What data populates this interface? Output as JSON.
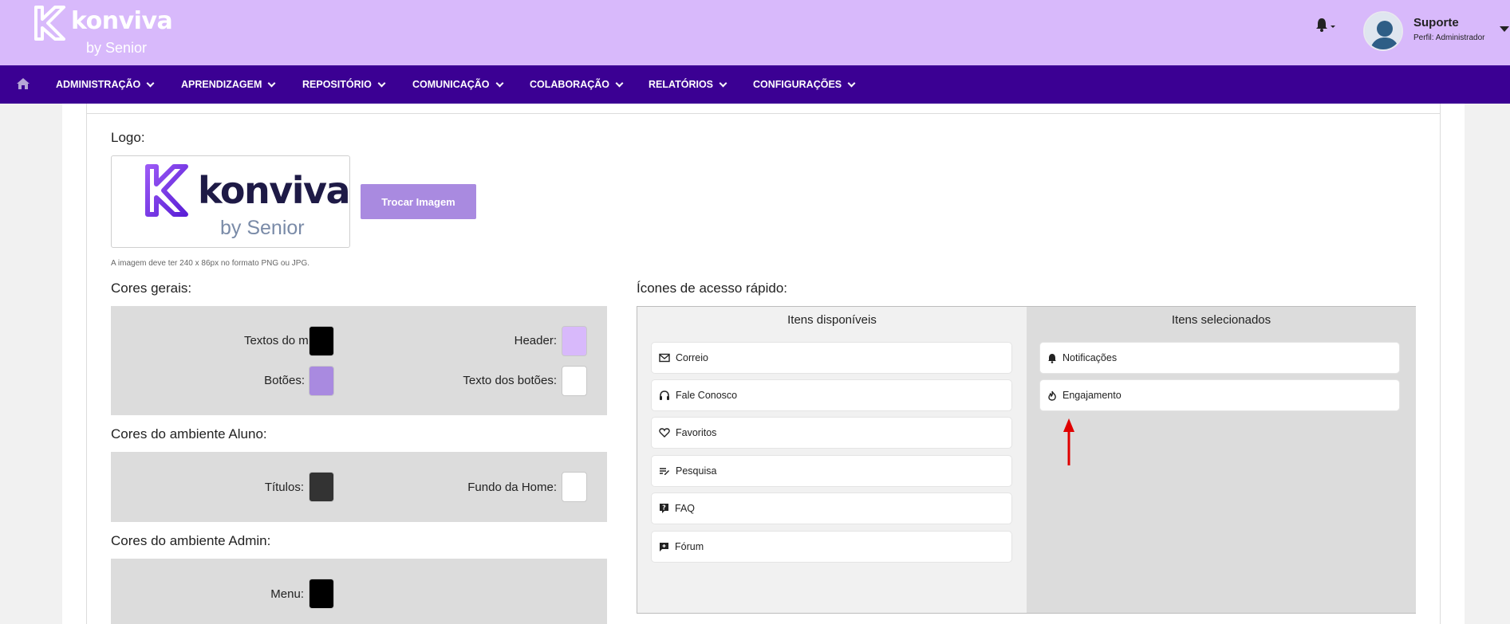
{
  "header": {
    "brand_name": "konviva",
    "brand_by": "by Senior",
    "user_name": "Suporte",
    "user_role": "Perfil: Administrador",
    "brand_color": "#d8b9fb"
  },
  "nav": {
    "bg_color": "#3b0093",
    "items": [
      {
        "label": "ADMINISTRAÇÃO"
      },
      {
        "label": "APRENDIZAGEM"
      },
      {
        "label": "REPOSITÓRIO"
      },
      {
        "label": "COMUNICAÇÃO"
      },
      {
        "label": "COLABORAÇÃO"
      },
      {
        "label": "RELATÓRIOS"
      },
      {
        "label": "CONFIGURAÇÕES"
      }
    ]
  },
  "logo_section": {
    "title": "Logo:",
    "preview_word": "konviva",
    "preview_by": "by Senior",
    "swap_button": "Trocar Imagem",
    "hint": "A imagem deve ter 240 x 86px no formato PNG ou JPG."
  },
  "general_colors": {
    "title": "Cores gerais:",
    "fields": [
      {
        "label": "Textos do menu:",
        "color": "#000000"
      },
      {
        "label": "Header:",
        "color": "#d8b9fb"
      },
      {
        "label": "Botões:",
        "color": "#a98ae0"
      },
      {
        "label": "Texto dos botões:",
        "color": "#ffffff"
      }
    ]
  },
  "student_colors": {
    "title": "Cores do ambiente Aluno:",
    "fields": [
      {
        "label": "Títulos:",
        "color": "#333333"
      },
      {
        "label": "Fundo da Home:",
        "color": "#ffffff"
      }
    ]
  },
  "admin_colors": {
    "title": "Cores do ambiente Admin:",
    "fields": [
      {
        "label": "Menu:",
        "color": "#000000"
      }
    ]
  },
  "quick_access": {
    "title": "Ícones de acesso rápido:",
    "available_title": "Itens disponíveis",
    "selected_title": "Itens selecionados",
    "available": [
      {
        "label": "Correio",
        "icon": "mail-icon"
      },
      {
        "label": "Fale Conosco",
        "icon": "headset-icon"
      },
      {
        "label": "Favoritos",
        "icon": "heart-icon"
      },
      {
        "label": "Pesquisa",
        "icon": "survey-icon"
      },
      {
        "label": "FAQ",
        "icon": "question-icon"
      },
      {
        "label": "Fórum",
        "icon": "forum-icon"
      }
    ],
    "selected": [
      {
        "label": "Notificações",
        "icon": "bell-icon"
      },
      {
        "label": "Engajamento",
        "icon": "flame-icon"
      }
    ]
  },
  "annotation_color": "#e00000"
}
